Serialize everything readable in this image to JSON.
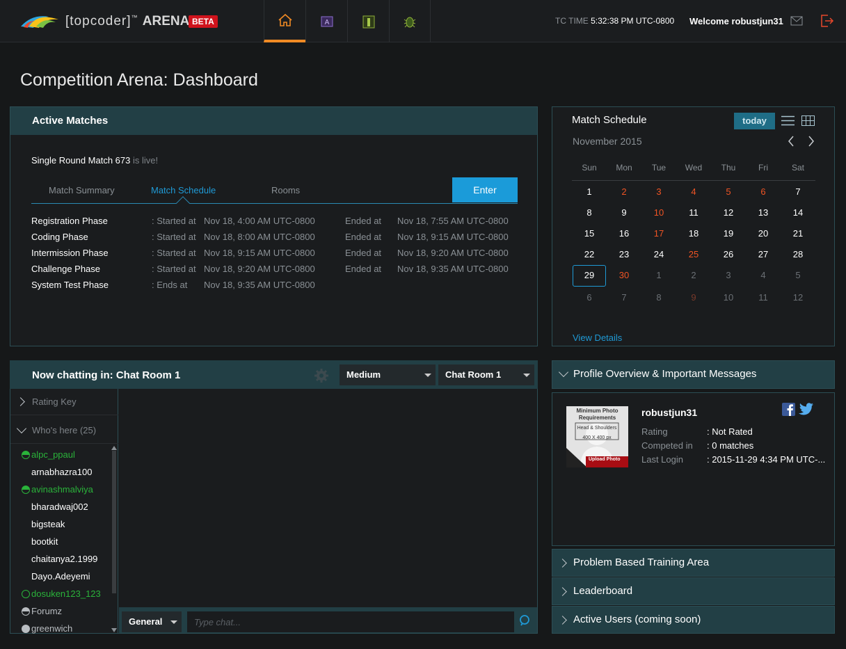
{
  "topbar": {
    "brand_bracketed": "[topcoder]",
    "brand_tm": "™",
    "brand_arena": "ARENA",
    "beta": "BETA",
    "tc_time_label": "TC TIME",
    "tc_time_value": "5:32:38 PM UTC-0800",
    "welcome": "Welcome robustjun31",
    "nav": [
      {
        "name": "home-icon",
        "active": true
      },
      {
        "name": "arena-icon"
      },
      {
        "name": "practice-icon"
      },
      {
        "name": "bug-icon"
      }
    ],
    "accent": "#f08a24"
  },
  "page_title": "Competition Arena: Dashboard",
  "active_matches": {
    "title": "Active Matches",
    "match_name": "Single Round Match 673",
    "live_text": "is live!",
    "tabs": [
      "Match Summary",
      "Match Schedule",
      "Rooms"
    ],
    "active_tab": "Match Schedule",
    "enter_label": "Enter",
    "phases": [
      {
        "name": "Registration Phase",
        "start_label": ": Started at",
        "start": "Nov 18, 4:00 AM UTC-0800",
        "end_label": "Ended at",
        "end": "Nov 18, 7:55 AM UTC-0800"
      },
      {
        "name": "Coding Phase",
        "start_label": ": Started at",
        "start": "Nov 18, 8:00 AM UTC-0800",
        "end_label": "Ended at",
        "end": "Nov 18, 9:15 AM UTC-0800"
      },
      {
        "name": "Intermission Phase",
        "start_label": ": Started at",
        "start": "Nov 18, 9:15 AM UTC-0800",
        "end_label": "Ended at",
        "end": "Nov 18, 9:20 AM UTC-0800"
      },
      {
        "name": "Challenge Phase",
        "start_label": ": Started at",
        "start": "Nov 18, 9:20 AM UTC-0800",
        "end_label": "Ended at",
        "end": "Nov 18, 9:35 AM UTC-0800"
      },
      {
        "name": "System Test Phase",
        "start_label": ": Ends at",
        "start": "Nov 18, 9:35 AM UTC-0800",
        "end_label": "",
        "end": ""
      }
    ]
  },
  "match_schedule": {
    "title": "Match Schedule",
    "today_label": "today",
    "month": "November 2015",
    "days_of_week": [
      "Sun",
      "Mon",
      "Tue",
      "Wed",
      "Thu",
      "Fri",
      "Sat"
    ],
    "weeks": [
      [
        "1",
        "2",
        "3",
        "4",
        "5",
        "6",
        "7"
      ],
      [
        "8",
        "9",
        "10",
        "11",
        "12",
        "13",
        "14"
      ],
      [
        "15",
        "16",
        "17",
        "18",
        "19",
        "20",
        "21"
      ],
      [
        "22",
        "23",
        "24",
        "25",
        "26",
        "27",
        "28"
      ],
      [
        "29",
        "30",
        "1",
        "2",
        "3",
        "4",
        "5"
      ],
      [
        "6",
        "7",
        "8",
        "9",
        "10",
        "11",
        "12"
      ]
    ],
    "highlight_color": "#f05424",
    "selected_day": "29",
    "view_details": "View Details"
  },
  "chat": {
    "title": "Now chatting in: Chat Room 1",
    "level_select": "Medium",
    "room_select": "Chat Room 1",
    "rating_key": "Rating Key",
    "whos_here": "Who's here (25)",
    "users": [
      {
        "name": "alpc_ppaul",
        "status": "green-half"
      },
      {
        "name": "arnabhazra100",
        "status": ""
      },
      {
        "name": "avinashmalviya",
        "status": "green-half"
      },
      {
        "name": "bharadwaj002",
        "status": ""
      },
      {
        "name": "bigsteak",
        "status": ""
      },
      {
        "name": "bootkit",
        "status": ""
      },
      {
        "name": "chaitanya2.1999",
        "status": ""
      },
      {
        "name": "Dayo.Adeyemi",
        "status": ""
      },
      {
        "name": "dosuken123_123",
        "status": "green-ring"
      },
      {
        "name": "Forumz",
        "status": "grey-half"
      },
      {
        "name": "greenwich",
        "status": "grey-full"
      }
    ],
    "scope_select": "General",
    "input_placeholder": "Type chat..."
  },
  "profile": {
    "title": "Profile Overview & Important Messages",
    "photo_text_1": "Minimum Photo Requirements",
    "photo_text_2": "Head & Shoulders",
    "photo_text_3": "400 X 400 px",
    "photo_upload": "Upload Photo",
    "username": "robustjun31",
    "rows": [
      {
        "label": "Rating",
        "value": ": Not Rated"
      },
      {
        "label": "Competed in",
        "value": ": 0 matches"
      },
      {
        "label": "Last Login",
        "value": ": 2015-11-29 4:34 PM UTC-..."
      }
    ]
  },
  "accordions": [
    "Problem Based Training Area",
    "Leaderboard",
    "Active Users (coming soon)"
  ]
}
